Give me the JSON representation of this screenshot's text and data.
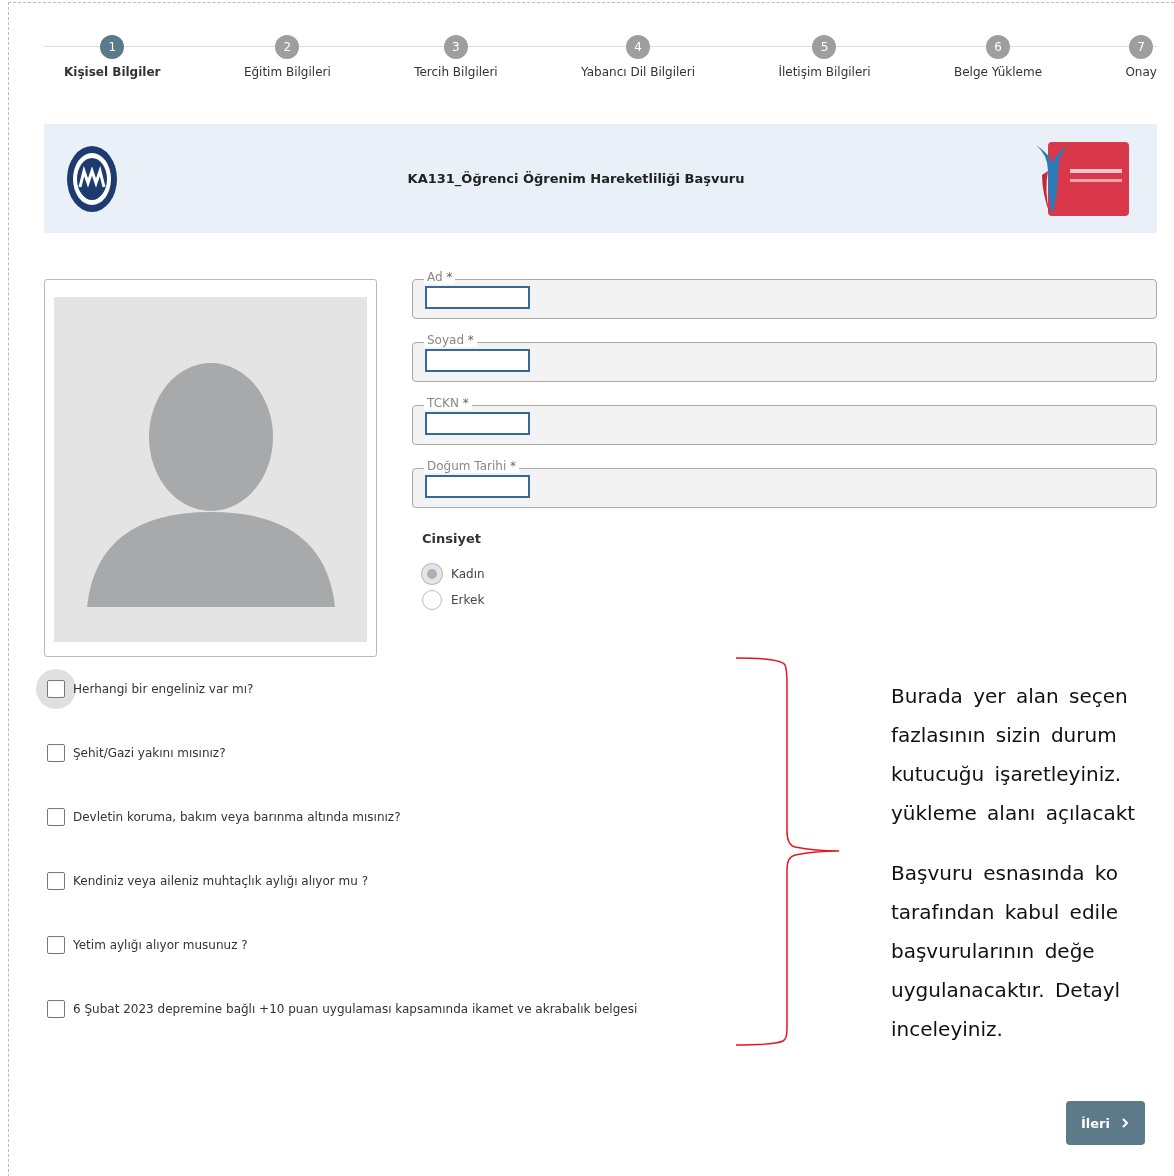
{
  "steps": [
    {
      "number": "1",
      "label": "Kişisel Bilgiler",
      "selected": true
    },
    {
      "number": "2",
      "label": "Eğitim Bilgileri",
      "selected": false
    },
    {
      "number": "3",
      "label": "Tercih Bilgileri",
      "selected": false
    },
    {
      "number": "4",
      "label": "Yabancı Dil Bilgileri",
      "selected": false
    },
    {
      "number": "5",
      "label": "İletişim Bilgileri",
      "selected": false
    },
    {
      "number": "6",
      "label": "Belge Yükleme",
      "selected": false
    },
    {
      "number": "7",
      "label": "Onay",
      "selected": false
    }
  ],
  "banner": {
    "title": "KA131_Öğrenci Öğrenim Hareketliliği Başvuru"
  },
  "fields": [
    {
      "label": "Ad",
      "marker": "*"
    },
    {
      "label": "Soyad",
      "marker": "*"
    },
    {
      "label": "TCKN",
      "marker": "*"
    },
    {
      "label": "Doğum Tarihi",
      "marker": "*"
    }
  ],
  "gender": {
    "label": "Cinsiyet",
    "options": [
      {
        "label": "Kadın",
        "selected": true
      },
      {
        "label": "Erkek",
        "selected": false
      }
    ]
  },
  "checkboxes": [
    {
      "label": "Herhangi bir engeliniz var mı?",
      "checked": false,
      "focused": true
    },
    {
      "label": "Şehit/Gazi yakını mısınız?",
      "checked": false,
      "focused": false
    },
    {
      "label": "Devletin koruma, bakım veya barınma altında mısınız?",
      "checked": false,
      "focused": false
    },
    {
      "label": "Kendiniz veya aileniz muhtaçlık aylığı alıyor mu ?",
      "checked": false,
      "focused": false
    },
    {
      "label": "Yetim aylığı alıyor musunuz ?",
      "checked": false,
      "focused": false
    },
    {
      "label": "6 Şubat 2023 depremine bağlı +10 puan uygulaması kapsamında ikamet ve akrabalık belgesi",
      "checked": false,
      "focused": false
    }
  ],
  "annotation": {
    "paragraphs": [
      [
        "Burada yer alan seçen",
        "fazlasının sizin durum",
        "kutucuğu işaretleyiniz.",
        "yükleme alanı açılacakt"
      ],
      [
        "Başvuru esnasında ko",
        "tarafından kabul edile",
        "başvurularının değe",
        "uygulanacaktır. Detayl",
        "inceleyiniz."
      ]
    ]
  },
  "next_button": {
    "label": "İleri"
  }
}
